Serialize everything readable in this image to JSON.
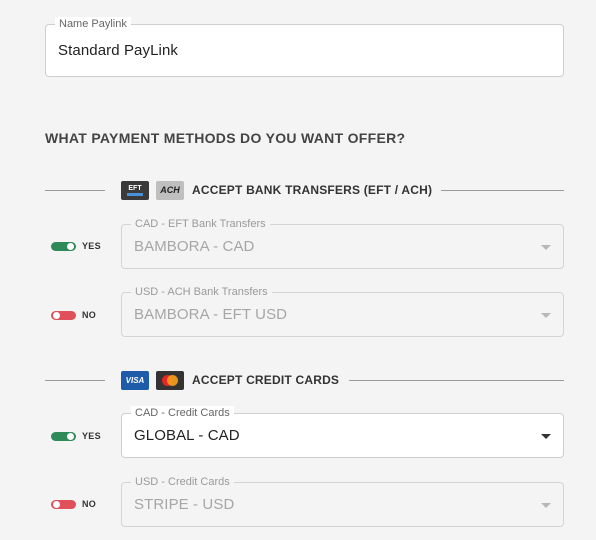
{
  "paylink_name": {
    "legend": "Name Paylink",
    "value": "Standard PayLink"
  },
  "payment_methods_heading": "WHAT PAYMENT METHODS DO YOU WANT OFFER?",
  "bank_transfers": {
    "label": "ACCEPT BANK TRANSFERS (EFT / ACH)",
    "icons": [
      "eft-icon",
      "ach-icon"
    ],
    "eft_badge_text": "EFT",
    "ach_badge_text": "ACH",
    "rows": [
      {
        "toggle": "on",
        "toggle_label": "YES",
        "legend": "CAD - EFT Bank Transfers",
        "value": "BAMBORA - CAD",
        "disabled": true
      },
      {
        "toggle": "off",
        "toggle_label": "NO",
        "legend": "USD - ACH Bank Transfers",
        "value": "BAMBORA - EFT USD",
        "disabled": true
      }
    ]
  },
  "credit_cards": {
    "label": "ACCEPT CREDIT CARDS",
    "icons": [
      "visa-icon",
      "mastercard-icon"
    ],
    "visa_badge_text": "VISA",
    "rows": [
      {
        "toggle": "on",
        "toggle_label": "YES",
        "legend": "CAD - Credit Cards",
        "value": "GLOBAL - CAD",
        "disabled": false
      },
      {
        "toggle": "off",
        "toggle_label": "NO",
        "legend": "USD - Credit Cards",
        "value": "STRIPE - USD",
        "disabled": true
      }
    ]
  },
  "colors": {
    "toggle_on": "#2e8b57",
    "toggle_off": "#e0505a",
    "visa_blue": "#1e5ba8"
  }
}
